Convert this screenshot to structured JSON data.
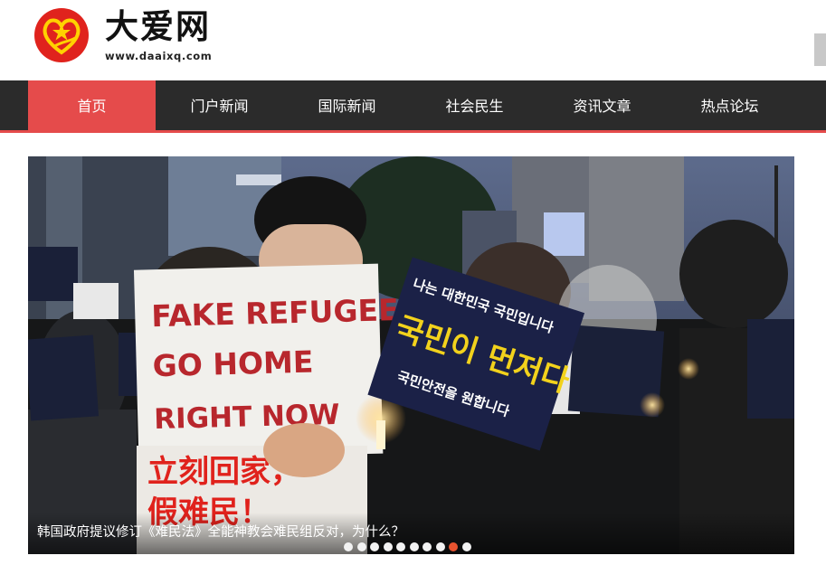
{
  "site": {
    "name": "大爱网",
    "url": "www.daaixq.com"
  },
  "nav": {
    "items": [
      {
        "label": "首页",
        "active": true
      },
      {
        "label": "门户新闻",
        "active": false
      },
      {
        "label": "国际新闻",
        "active": false
      },
      {
        "label": "社会民生",
        "active": false
      },
      {
        "label": "资讯文章",
        "active": false
      },
      {
        "label": "热点论坛",
        "active": false
      }
    ]
  },
  "banner": {
    "caption": "韩国政府提议修订《难民法》全能神教会难民组反对，为什么？",
    "slide_count": 10,
    "active_slide": 9,
    "photo_text": {
      "main_sign_line1": "FAKE REFUGEES",
      "main_sign_line2": "GO HOME",
      "main_sign_line3": "RIGHT NOW",
      "main_sign_chinese": "立刻回家，",
      "main_sign_chinese2": "假难民！",
      "blue_sign_top": "나는 대한민국 국민입니다",
      "blue_sign_main": "국민이 먼저다",
      "blue_sign_bottom": "국민안전을 원합니다"
    }
  },
  "colors": {
    "accent": "#e54b4b",
    "nav_bg": "#2b2b2b",
    "active_dot": "#e8532f"
  }
}
